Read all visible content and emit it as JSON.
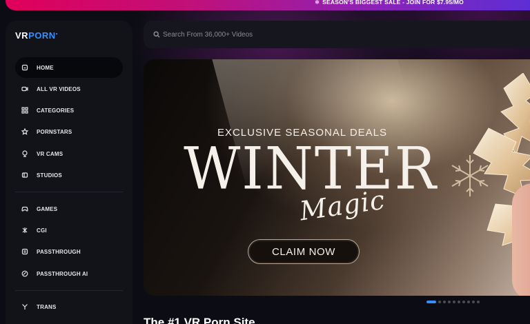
{
  "promo": {
    "text": "SEASON'S BIGGEST SALE - JOIN FOR $7.95/MO",
    "icon": "snowflake-icon"
  },
  "brand": {
    "logo_prefix": "VR",
    "logo_o": "P",
    "logo_suffix": "ORN",
    "accent": "#3a8dff"
  },
  "search": {
    "placeholder": "Search From 36,000+ Videos"
  },
  "sidebar": {
    "items": [
      {
        "label": "HOME",
        "icon": "home-icon",
        "active": true
      },
      {
        "label": "ALL VR VIDEOS",
        "icon": "video-icon"
      },
      {
        "label": "CATEGORIES",
        "icon": "grid-icon"
      },
      {
        "label": "PORNSTARS",
        "icon": "star-icon"
      },
      {
        "label": "VR CAMS",
        "icon": "webcam-icon"
      },
      {
        "label": "STUDIOS",
        "icon": "studio-icon"
      },
      {
        "label": "GAMES",
        "icon": "gamepad-icon"
      },
      {
        "label": "CGI",
        "icon": "cgi-icon"
      },
      {
        "label": "PASSTHROUGH",
        "icon": "passthrough-icon"
      },
      {
        "label": "PASSTHROUGH AI",
        "icon": "ai-icon"
      },
      {
        "label": "TRANS",
        "icon": "trans-icon"
      }
    ]
  },
  "hero": {
    "subtitle": "EXCLUSIVE SEASONAL DEALS",
    "title": "WINTER",
    "script": "Magic",
    "cta": "CLAIM NOW",
    "slides_total": 10,
    "slide_active": 1
  },
  "section": {
    "title": "The #1 VR Porn Site"
  }
}
